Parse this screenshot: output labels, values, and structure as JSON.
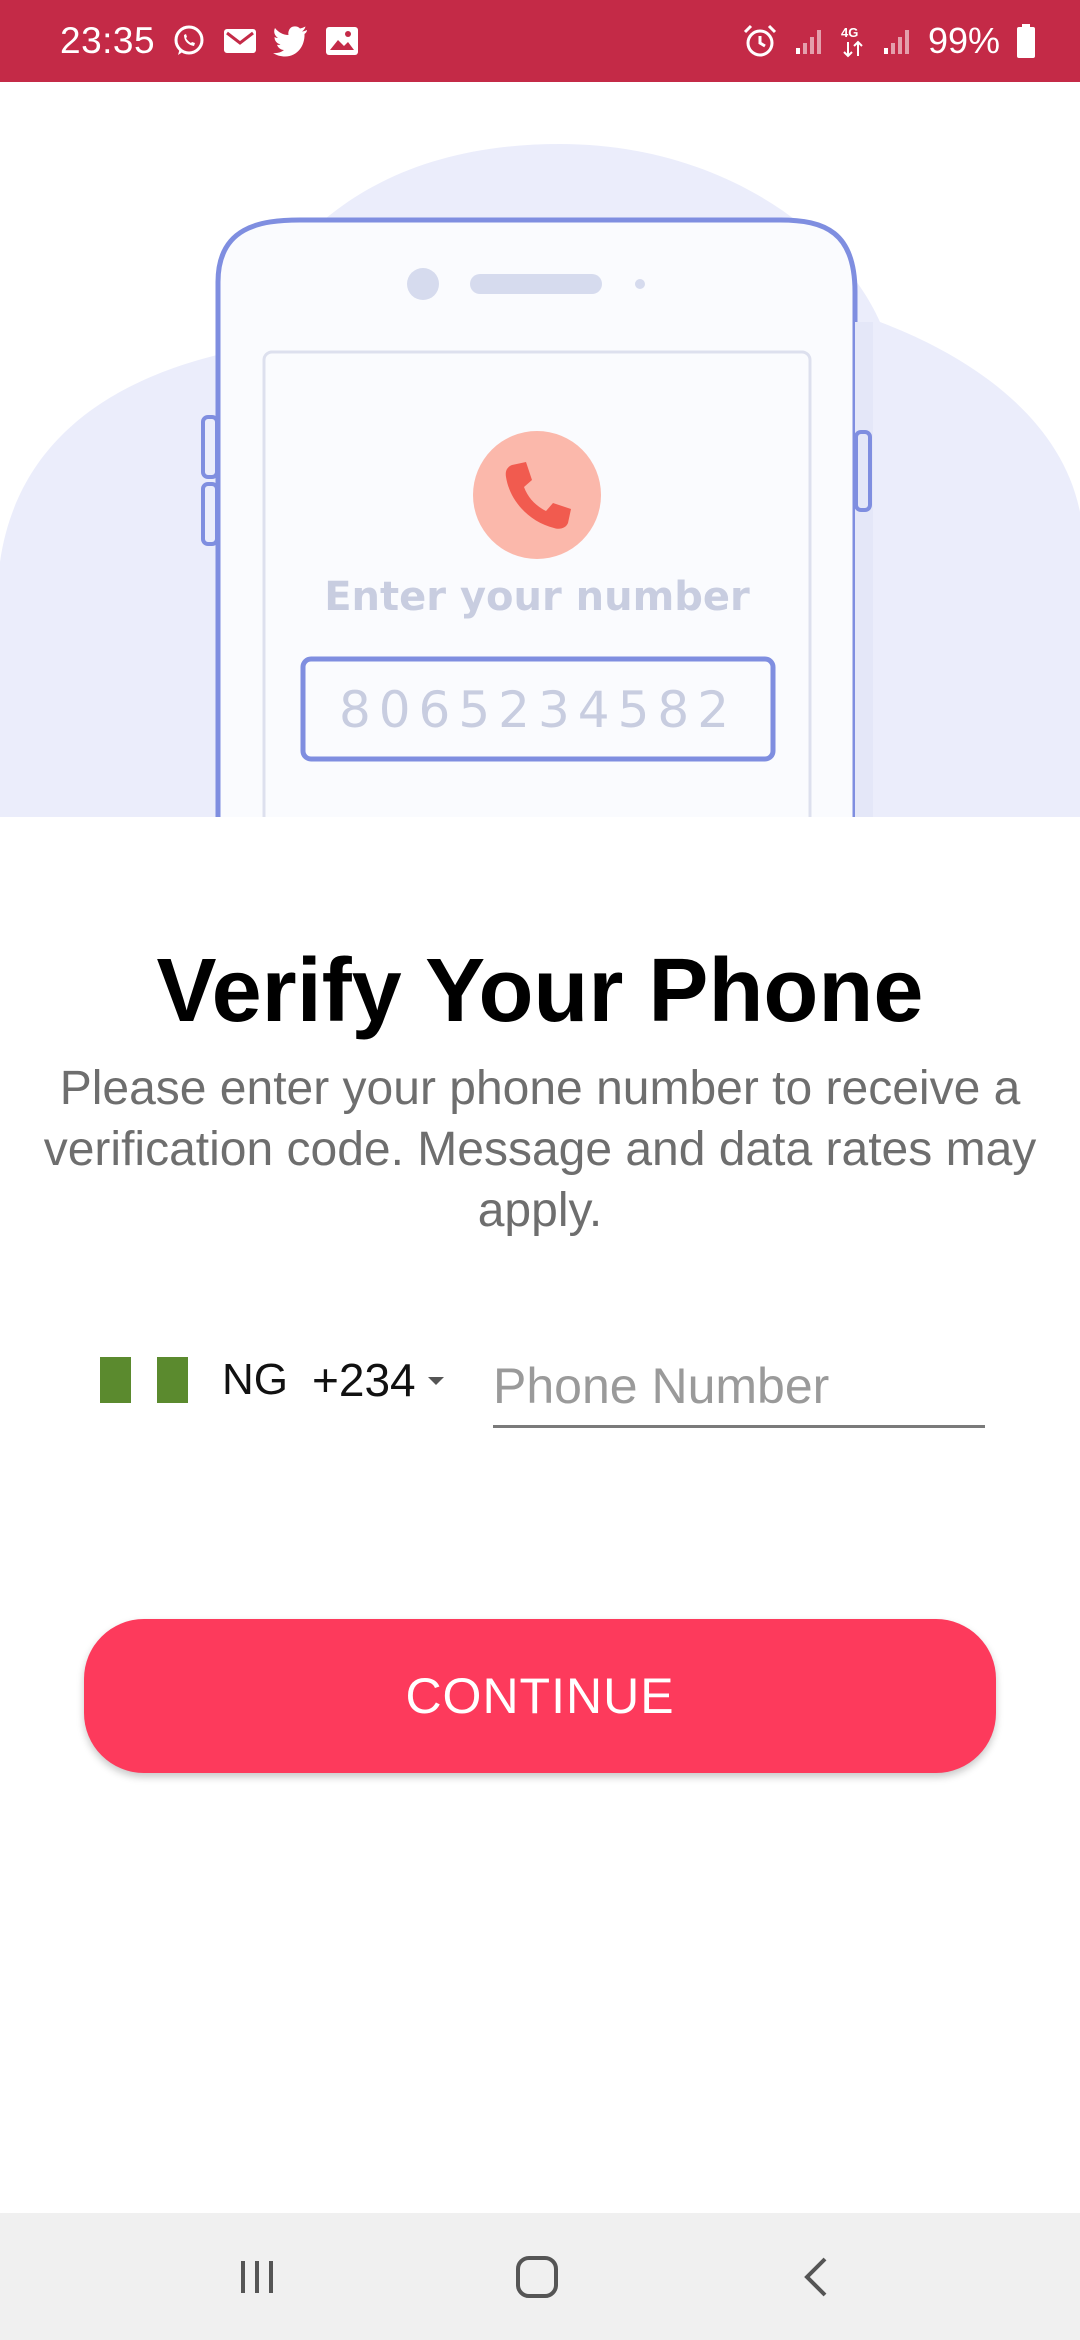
{
  "status_bar": {
    "time": "23:35",
    "battery": "99%",
    "notification_icons": [
      "whatsapp-icon",
      "gmail-icon",
      "twitter-icon",
      "gallery-icon"
    ],
    "system_icons": [
      "alarm-icon",
      "signal-icon",
      "4g-icon",
      "signal-icon",
      "battery-icon"
    ],
    "network_label": "4G"
  },
  "illustration": {
    "prompt_text": "Enter your number",
    "sample_number": "8065234582"
  },
  "main": {
    "title": "Verify Your Phone",
    "description": "Please enter your phone number to receive a verification code. Message and data rates may apply."
  },
  "phone_form": {
    "country_iso": "NG",
    "dial_code": "+234",
    "phone_placeholder": "Phone Number",
    "phone_value": ""
  },
  "actions": {
    "continue_label": "CONTINUE"
  },
  "colors": {
    "status_bar": "#c42a47",
    "accent": "#fd3a5c",
    "flag_green": "#5b8a2e",
    "illustration_outline": "#7f8ee0"
  }
}
